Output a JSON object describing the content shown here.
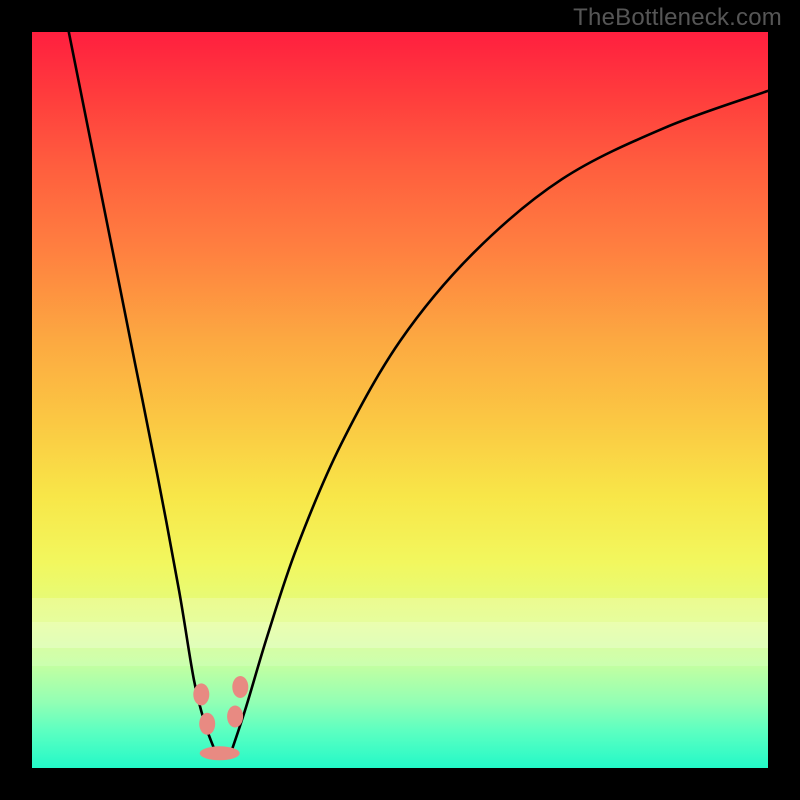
{
  "watermark": "TheBottleneck.com",
  "chart_data": {
    "type": "line",
    "title": "",
    "xlabel": "",
    "ylabel": "",
    "xlim": [
      0,
      100
    ],
    "ylim": [
      0,
      100
    ],
    "note": "Values are read off a label-free plot: x≈0–100 left→right, y≈0 bottom → 100 top. Two V-shaped curves meeting near x≈25.",
    "series": [
      {
        "name": "left-branch",
        "x": [
          5,
          8,
          11,
          14,
          17,
          20,
          22,
          23.5,
          25
        ],
        "y": [
          100,
          85,
          70,
          55,
          40,
          24,
          12,
          6,
          2
        ]
      },
      {
        "name": "right-branch",
        "x": [
          27,
          29,
          32,
          36,
          42,
          50,
          60,
          72,
          86,
          100
        ],
        "y": [
          2,
          8,
          18,
          30,
          44,
          58,
          70,
          80,
          87,
          92
        ]
      }
    ],
    "markers": [
      {
        "name": "left-dot-upper",
        "x": 23.0,
        "y": 10
      },
      {
        "name": "left-dot-lower",
        "x": 23.8,
        "y": 6
      },
      {
        "name": "right-dot-upper",
        "x": 28.3,
        "y": 11
      },
      {
        "name": "right-dot-lower",
        "x": 27.6,
        "y": 7
      },
      {
        "name": "valley-blob",
        "x": 25.5,
        "y": 2
      }
    ],
    "gradient_stops_percent_from_top": {
      "red": 0,
      "orange": 35,
      "yellow": 65,
      "pale_yellow_white": 80,
      "green_cyan": 100
    }
  }
}
